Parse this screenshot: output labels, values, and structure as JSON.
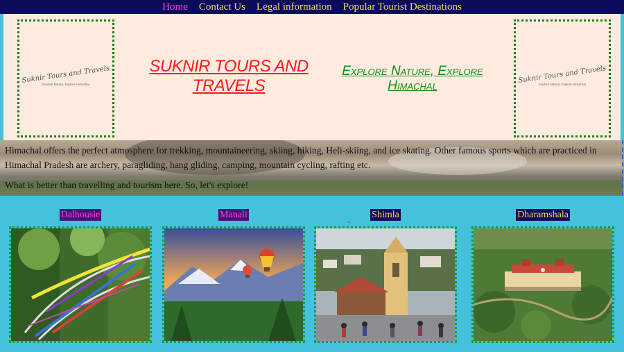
{
  "nav": {
    "items": [
      "Home",
      "Contact Us",
      "Legal information",
      "Popular Tourist Destinations"
    ],
    "active_color": "#ff3fcf",
    "color": "#f0dc5a",
    "background": "#0b0b5a"
  },
  "header": {
    "logo_name": "Suknir Tours and Travels",
    "logo_tagline": "Explore Nature, Explore Himachal",
    "title": "SUKNIR TOURS AND TRAVELS",
    "tagline": "Explore Nature, Explore Himachal"
  },
  "hero": {
    "paragraph1": "Himachal offers the perfect atmosphere for trekking, mountaineering, skiing, hiking, Heli-skiing, and ice skating. Other famous sports which are practiced in Himachal Pradesh are archery, paragliding, hang gliding, camping, mountain cycling, rafting etc.",
    "paragraph2": "What is better than travelling and tourism here. So, let's explore!"
  },
  "destinations": [
    {
      "name": "Dalhousie",
      "text_color": "#ff3fcf",
      "label_bg": "#44147a"
    },
    {
      "name": "Manali",
      "text_color": "#ff3fcf",
      "label_bg": "#44147a"
    },
    {
      "name": "Shimla",
      "text_color": "#f0dc5a",
      "label_bg": "#0b0b5a"
    },
    {
      "name": "Dharamshala",
      "text_color": "#f0dc5a",
      "label_bg": "#0b0b5a"
    }
  ]
}
